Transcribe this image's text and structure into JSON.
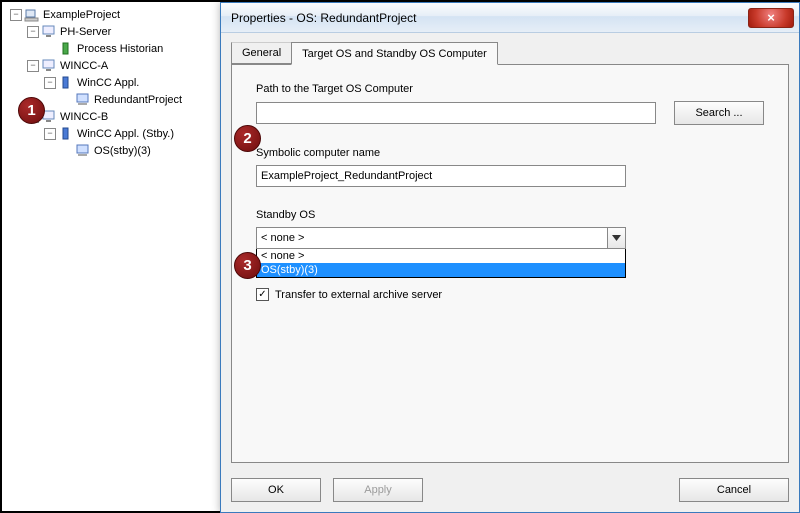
{
  "tree": {
    "root": "ExampleProject",
    "n_ph_server": "PH-Server",
    "n_process_historian": "Process Historian",
    "n_wincc_a": "WINCC-A",
    "n_wincc_appl": "WinCC Appl.",
    "n_redundant_project": "RedundantProject",
    "n_wincc_b": "WINCC-B",
    "n_wincc_appl_stby": "WinCC Appl. (Stby.)",
    "n_os_stby3": "OS(stby)(3)"
  },
  "dialog": {
    "title": "Properties - OS: RedundantProject",
    "tabs": {
      "general": "General",
      "target": "Target OS and Standby OS Computer"
    },
    "labels": {
      "path": "Path to the Target OS Computer",
      "symbolic": "Symbolic computer name",
      "standby": "Standby OS",
      "transfer": "Transfer to external archive server"
    },
    "fields": {
      "path_value": "",
      "symbolic_value": "ExampleProject_RedundantProject",
      "standby_selected": "< none >"
    },
    "standby_options": {
      "opt0": "< none >",
      "opt1": "OS(stby)(3)"
    },
    "buttons": {
      "search": "Search ...",
      "ok": "OK",
      "apply": "Apply",
      "cancel": "Cancel"
    }
  },
  "callouts": {
    "c1": "1",
    "c2": "2",
    "c3": "3"
  }
}
